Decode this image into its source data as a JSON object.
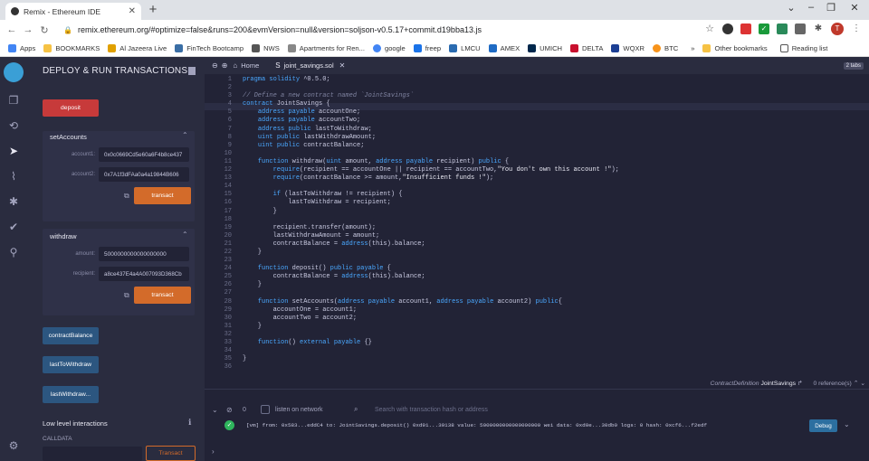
{
  "browser": {
    "tab_title": "Remix - Ethereum IDE",
    "url": "remix.ethereum.org/#optimize=false&runs=200&evmVersion=null&version=soljson-v0.5.17+commit.d19bba13.js",
    "profile_initial": "T",
    "bookmarks": [
      "Apps",
      "BOOKMARKS",
      "Al Jazeera Live",
      "FinTech Bootcamp",
      "NWS",
      "Apartments for Ren...",
      "google",
      "freep",
      "LMCU",
      "AMEX",
      "UMICH",
      "DELTA",
      "WQXR",
      "BTC"
    ],
    "other_bookmarks": "Other bookmarks",
    "reading_list": "Reading list"
  },
  "panel": {
    "title": "DEPLOY & RUN TRANSACTIONS",
    "deposit_label": "deposit",
    "setAccounts": {
      "title": "setAccounts",
      "account1_label": "account1:",
      "account1_value": "0x0c0669Cd5e60a6F4b8ce437",
      "account2_label": "account2:",
      "account2_value": "0x7A1f3dFAa0a4a19844B606",
      "transact": "transact"
    },
    "withdraw": {
      "title": "withdraw",
      "amount_label": "amount:",
      "amount_value": "5000000000000000000",
      "recipient_label": "recipient:",
      "recipient_value": "a8ce437E4a4A007093D368Cb",
      "transact": "transact"
    },
    "contractBalance": "contractBalance",
    "lastToWithdraw": "lastToWithdraw",
    "lastWithdraw": "lastWithdraw...",
    "low_level": "Low level interactions",
    "calldata": "CALLDATA",
    "transact_bottom": "Transact"
  },
  "editor": {
    "home_tab": "Home",
    "file_tab": "joint_savings.sol",
    "tabs_badge": "2 tabs",
    "lines": [
      "pragma solidity ^0.5.0;",
      "",
      "// Define a new contract named `JointSavings`",
      "contract JointSavings {",
      "    address payable accountOne;",
      "    address payable accountTwo;",
      "    address public lastToWithdraw;",
      "    uint public lastWithdrawAmount;",
      "    uint public contractBalance;",
      "",
      "    function withdraw(uint amount, address payable recipient) public {",
      "        require(recipient == accountOne || recipient == accountTwo,\"You don't own this account !\");",
      "        require(contractBalance >= amount,\"Insufficient funds !\");",
      "",
      "        if (lastToWithdraw != recipient) {",
      "            lastToWithdraw = recipient;",
      "        }",
      "",
      "        recipient.transfer(amount);",
      "        lastWithdrawAmount = amount;",
      "        contractBalance = address(this).balance;",
      "    }",
      "",
      "    function deposit() public payable {",
      "        contractBalance = address(this).balance;",
      "    }",
      "",
      "    function setAccounts(address payable account1, address payable account2) public{",
      "        accountOne = account1;",
      "        accountTwo = account2;",
      "    }",
      "",
      "    function() external payable {}",
      "",
      "}",
      ""
    ],
    "status_def": "ContractDefinition",
    "status_name": "JointSavings",
    "status_refs": "0 reference(s)"
  },
  "terminal": {
    "count": "0",
    "listen": "listen on network",
    "search_placeholder": "Search with transaction hash or address",
    "log": "[vm] from: 0x583...eddC4 to: JointSavings.deposit() 0xd91...39138 value: 5000000000000000000 wei data: 0xd0e...30db0 logs: 0 hash: 0xcf6...f2edf",
    "debug": "Debug"
  }
}
